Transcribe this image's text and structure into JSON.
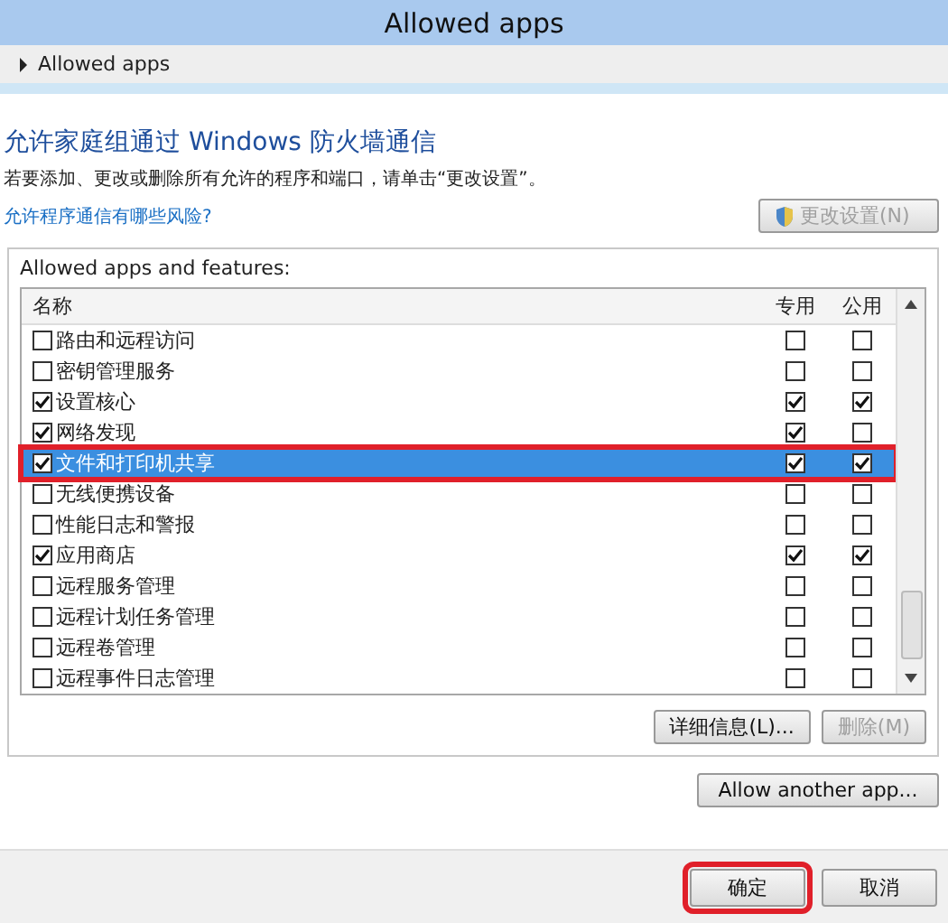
{
  "window": {
    "title": "Allowed apps"
  },
  "breadcrumb": {
    "current": "Allowed apps"
  },
  "heading": "允许家庭组通过 Windows 防火墙通信",
  "description": "若要添加、更改或删除所有允许的程序和端口，请单击“更改设置”。",
  "risk_link": "允许程序通信有哪些风险?",
  "change_settings": {
    "label": "更改设置(N)",
    "disabled": true
  },
  "group": {
    "label": "Allowed apps and features:",
    "columns": [
      "名称",
      "专用",
      "公用"
    ],
    "rows": [
      {
        "name": "路由和远程访问",
        "checked": false,
        "private": false,
        "public": false,
        "selected": false,
        "marked": false
      },
      {
        "name": "密钥管理服务",
        "checked": false,
        "private": false,
        "public": false,
        "selected": false,
        "marked": false
      },
      {
        "name": "设置核心",
        "checked": true,
        "private": true,
        "public": true,
        "selected": false,
        "marked": false
      },
      {
        "name": "网络发现",
        "checked": true,
        "private": true,
        "public": false,
        "selected": false,
        "marked": false
      },
      {
        "name": "文件和打印机共享",
        "checked": true,
        "private": true,
        "public": true,
        "selected": true,
        "marked": true
      },
      {
        "name": "无线便携设备",
        "checked": false,
        "private": false,
        "public": false,
        "selected": false,
        "marked": false
      },
      {
        "name": "性能日志和警报",
        "checked": false,
        "private": false,
        "public": false,
        "selected": false,
        "marked": false
      },
      {
        "name": "应用商店",
        "checked": true,
        "private": true,
        "public": true,
        "selected": false,
        "marked": false
      },
      {
        "name": "远程服务管理",
        "checked": false,
        "private": false,
        "public": false,
        "selected": false,
        "marked": false
      },
      {
        "name": "远程计划任务管理",
        "checked": false,
        "private": false,
        "public": false,
        "selected": false,
        "marked": false
      },
      {
        "name": "远程卷管理",
        "checked": false,
        "private": false,
        "public": false,
        "selected": false,
        "marked": false
      },
      {
        "name": "远程事件日志管理",
        "checked": false,
        "private": false,
        "public": false,
        "selected": false,
        "marked": false
      }
    ],
    "buttons": [
      {
        "label": "详细信息(L)...",
        "disabled": false
      },
      {
        "label": "删除(M)",
        "disabled": true
      }
    ]
  },
  "allow_another": {
    "label": "Allow another app...",
    "disabled": false
  },
  "footer_buttons": [
    {
      "label": "确定",
      "marked": true
    },
    {
      "label": "取消",
      "marked": false
    }
  ]
}
